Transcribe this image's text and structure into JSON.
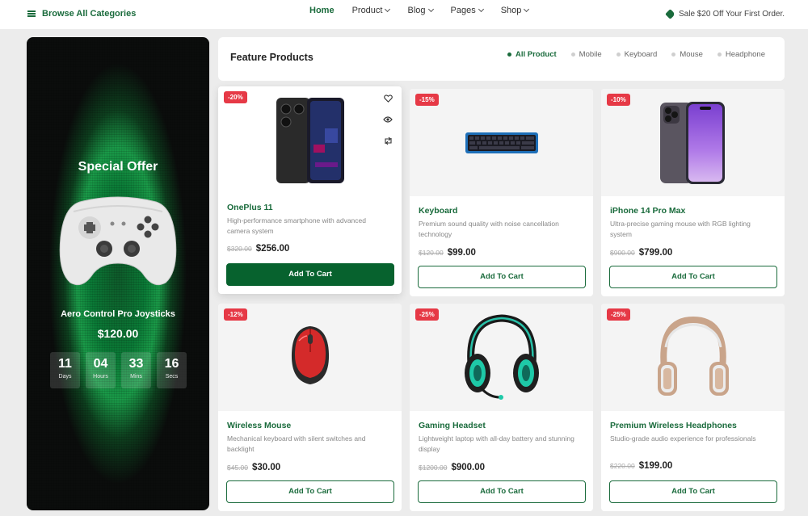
{
  "topbar": {
    "browse_label": "Browse All Categories",
    "nav": [
      {
        "label": "Home",
        "active": true,
        "dropdown": false
      },
      {
        "label": "Product",
        "active": false,
        "dropdown": true
      },
      {
        "label": "Blog",
        "active": false,
        "dropdown": true
      },
      {
        "label": "Pages",
        "active": false,
        "dropdown": true
      },
      {
        "label": "Shop",
        "active": false,
        "dropdown": true
      }
    ],
    "promo_text": "Sale $20 Off Your First Order."
  },
  "offer": {
    "title": "Special Offer",
    "product_name": "Aero Control Pro Joysticks",
    "price": "$120.00",
    "countdown": [
      {
        "value": "11",
        "label": "Days"
      },
      {
        "value": "04",
        "label": "Hours"
      },
      {
        "value": "33",
        "label": "Mins"
      },
      {
        "value": "16",
        "label": "Secs"
      }
    ]
  },
  "products_header": {
    "title": "Feature Products",
    "filters": [
      {
        "label": "All Product",
        "active": true
      },
      {
        "label": "Mobile",
        "active": false
      },
      {
        "label": "Keyboard",
        "active": false
      },
      {
        "label": "Mouse",
        "active": false
      },
      {
        "label": "Headphone",
        "active": false
      }
    ]
  },
  "products": [
    {
      "discount": "-20%",
      "name": "OnePlus 11",
      "description": "High-performance smartphone with advanced camera system",
      "old_price": "$320.00",
      "price": "$256.00",
      "button": "Add To Cart",
      "image_icon": "phone-icon"
    },
    {
      "discount": "-15%",
      "name": "Keyboard",
      "description": "Premium sound quality with noise cancellation technology",
      "old_price": "$120.00",
      "price": "$99.00",
      "button": "Add To Cart",
      "image_icon": "keyboard-icon"
    },
    {
      "discount": "-10%",
      "name": "iPhone 14 Pro Max",
      "description": "Ultra-precise gaming mouse with RGB lighting system",
      "old_price": "$900.00",
      "price": "$799.00",
      "button": "Add To Cart",
      "image_icon": "phone-icon"
    },
    {
      "discount": "-12%",
      "name": "Wireless Mouse",
      "description": "Mechanical keyboard with silent switches and backlight",
      "old_price": "$45.00",
      "price": "$30.00",
      "button": "Add To Cart",
      "image_icon": "mouse-icon"
    },
    {
      "discount": "-25%",
      "name": "Gaming Headset",
      "description": "Lightweight laptop with all-day battery and stunning display",
      "old_price": "$1200.00",
      "price": "$900.00",
      "button": "Add To Cart",
      "image_icon": "headset-icon"
    },
    {
      "discount": "-25%",
      "name": "Premium Wireless Headphones",
      "description": "Studio-grade audio experience for professionals",
      "old_price": "$220.00",
      "price": "$199.00",
      "button": "Add To Cart",
      "image_icon": "headphones-icon"
    }
  ],
  "colors": {
    "accent": "#1a6b3c",
    "discount": "#e63946",
    "button_filled": "#07622e"
  }
}
